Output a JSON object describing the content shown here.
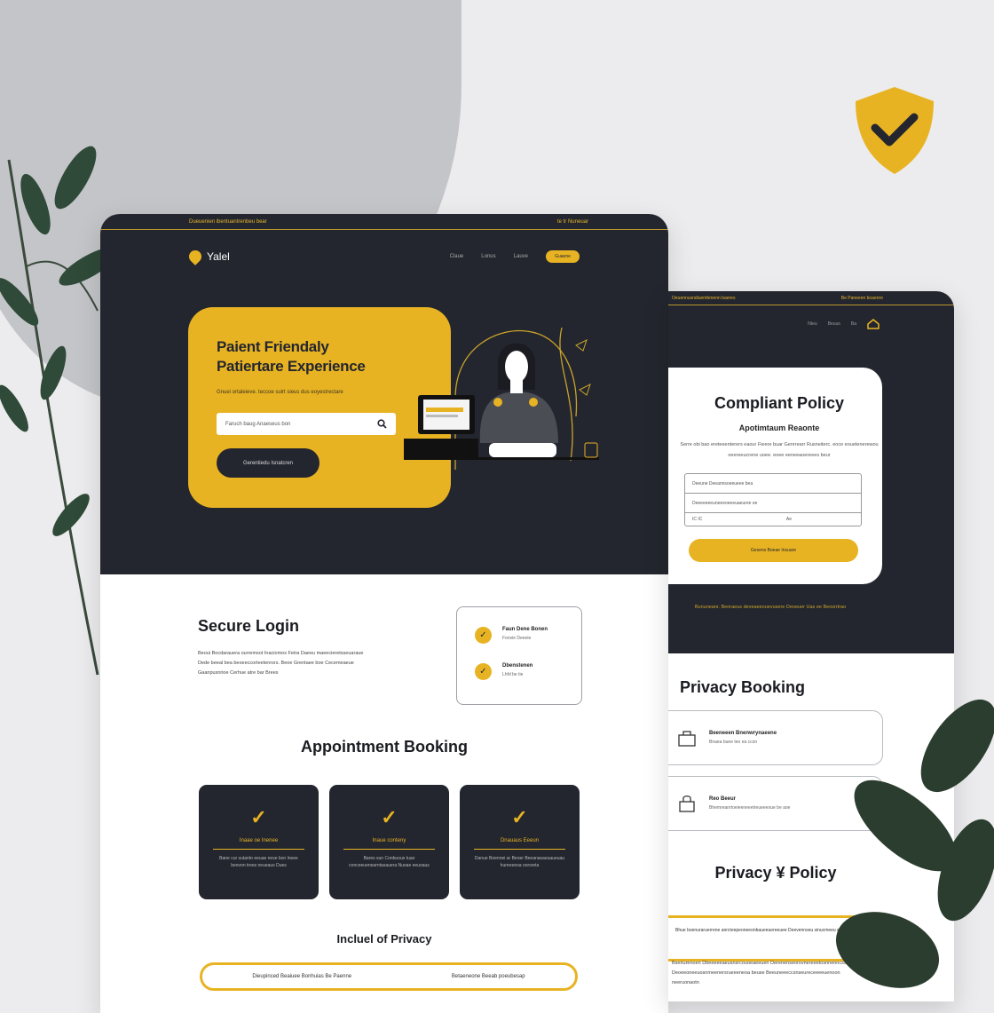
{
  "colors": {
    "accent": "#e8b323",
    "dark": "#24262f",
    "bg": "#ececee"
  },
  "left": {
    "topbar": {
      "left": "Dueuenien ibentuantrenbeu bear",
      "right": "te  tr  Nuneuar"
    },
    "nav": {
      "logo": "Yalel",
      "links": [
        "Claue",
        "Lonus",
        "Lauve"
      ],
      "button": "Guaene"
    },
    "hero": {
      "title_line1": "Paient Friendaly",
      "title_line2": "Patiertare Experience",
      "subtitle": "Gnuei ortaleieve. teccoe sulrt sieus dus eoyestrectare",
      "search_placeholder": "Faruch baug Anaeseus bon",
      "button": "Gerentiedu Isnatcren"
    },
    "login": {
      "title": "Secure Login",
      "text": "Beoui Bocdarauera ourremsot Inaciomos Fetra Daeeu maeecieretsseuaraue Dede beeal bea beoeeccorteetenrsrs. Beoe Grentaee boe Cecemeaeue Gaanpusnrioe Cerhue atre bar Brees",
      "items": [
        {
          "title": "Faun Dene Bonen",
          "sub": "Fonvie Deeeie"
        },
        {
          "title": "Dbenstenen",
          "sub": "Lhfd be tie"
        }
      ]
    },
    "booking": {
      "title": "Appointment Booking",
      "cards": [
        {
          "icon": "✓",
          "title": "Inaae oe Inenee",
          "text": "Bane cur sutanto eeuae nese bon lneee beovon trees neueaus Dues"
        },
        {
          "icon": "✓",
          "title": "Inaue conteny",
          "text": "Bares sun Conbuous tuao conceeuenearntasauera Nuoae eeuoaus"
        },
        {
          "icon": "✓",
          "title": "Dnauaus Eeeun",
          "text": "Danue Boennei ar Beoer Beeanasaeuaueuau hunreeeoa oorsreta"
        }
      ]
    },
    "included": {
      "title": "Incluel of Privacy",
      "items": [
        "Dieupinced Beaiuee Bonhuias Be Paenne",
        "Betaeneone Beeab poeubesap"
      ]
    }
  },
  "right": {
    "topbar": {
      "left": "Oeuennusndiuenttenenn baeres",
      "right": "Be  Paneeen boaenre"
    },
    "nav": {
      "links": [
        "Nteu",
        "Beuus",
        "Ba"
      ]
    },
    "complaint": {
      "title": "Compliant Policy",
      "subtitle": "Apotimtaum Reaonte",
      "text": "Serre obi bao ereteeenterers eaour Fieere buar Genrrearr Rusneiterc. eoce eouetenerewou oeereeucrene uoee. eoee eeneeaoereees beur",
      "fields": [
        "Deeune Deeannsoeeueee bea",
        "Deeeeeeeuneeeoeeeuaeuree ee"
      ],
      "field_small": "IC IC",
      "field_small_right": "Ae",
      "button": "Gesens Boeae Insuare"
    },
    "footer_text": "Bununeanr. Benraeus deveaeeouevusere Deoeuer Uas ee Beosrrtrao",
    "privacy_booking": {
      "title": "Privacy Booking",
      "items": [
        {
          "title": "Beeneeen Bnenwrynaeene",
          "sub": "Bnaea buee teo ea ccon"
        },
        {
          "title": "Reo Beeur",
          "sub": "Bhemreanrtoeieeneeetreueeeoue be aoe"
        }
      ]
    },
    "privacy_policy": {
      "title": "Privacy ¥ Policy",
      "box": "Bhue boenuraruerrene anrcteepeoneeonbaueeuereeuee Deevennseu sinucmeeu eoeaeo benen",
      "text": "Bseriurenoen Dbeeeeeaeusnsrcouoeaeeuen Derenenseorovnereeetosnnenncss Deoeeoneeuosnmeenersrueeeneoa beuse Beeuneeeccsnseureceeeeuenoon neeruonaotn"
    }
  }
}
